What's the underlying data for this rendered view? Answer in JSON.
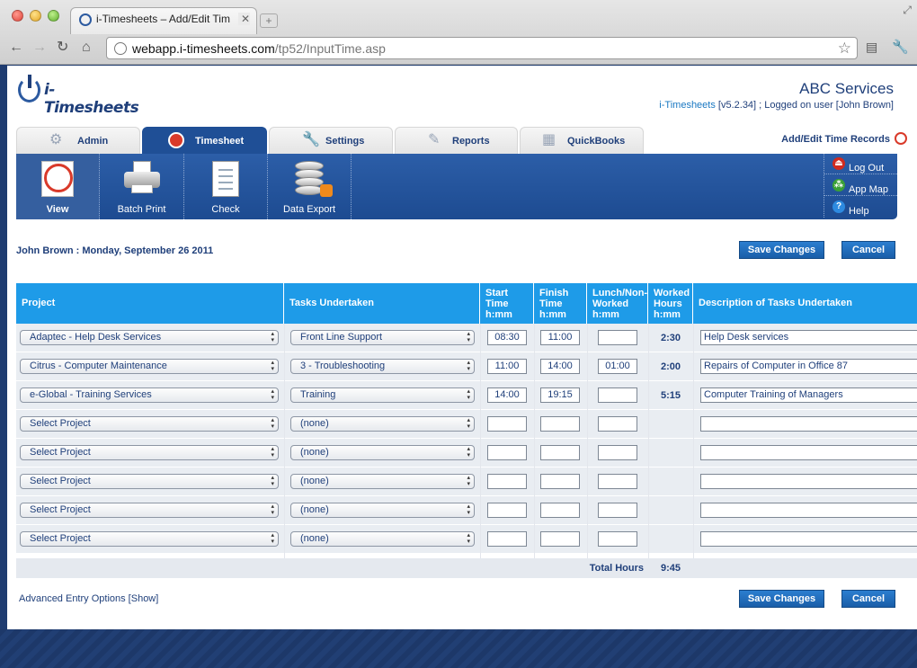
{
  "browser": {
    "tab_title": "i-Timesheets – Add/Edit Tim",
    "url_host": "webapp.i-timesheets.com",
    "url_path": "/tp52/InputTime.asp"
  },
  "header": {
    "logo_text": "i-Timesheets",
    "company": "ABC Services",
    "app_link": "i-Timesheets",
    "version_text": " [v5.2.34] ; Logged on user [John Brown]"
  },
  "tabs": [
    {
      "label": "Admin",
      "icon": "gear-icon"
    },
    {
      "label": "Timesheet",
      "icon": "clock-icon"
    },
    {
      "label": "Settings",
      "icon": "wrench-icon"
    },
    {
      "label": "Reports",
      "icon": "pen-icon"
    },
    {
      "label": "QuickBooks",
      "icon": "quickbooks-icon"
    }
  ],
  "page_heading": "Add/Edit Time Records",
  "toolbar": [
    {
      "label": "View",
      "icon": "clock-document-icon"
    },
    {
      "label": "Batch Print",
      "icon": "printer-icon"
    },
    {
      "label": "Check",
      "icon": "checklist-icon"
    },
    {
      "label": "Data Export",
      "icon": "database-export-icon"
    }
  ],
  "side_links": {
    "logout": "Log Out",
    "appmap": "App Map",
    "help": "Help"
  },
  "date_line": "John Brown : Monday, September 26 2011",
  "buttons": {
    "save": "Save Changes",
    "cancel": "Cancel"
  },
  "columns": {
    "project": "Project",
    "tasks": "Tasks Undertaken",
    "start": [
      "Start",
      "Time",
      "h:mm"
    ],
    "finish": [
      "Finish",
      "Time",
      "h:mm"
    ],
    "lunch": [
      "Lunch/Non-",
      "Worked",
      "h:mm"
    ],
    "worked": [
      "Worked",
      "Hours",
      "h:mm"
    ],
    "description": "Description of Tasks Undertaken"
  },
  "rows": [
    {
      "project": "Adaptec - Help Desk Services",
      "task": "Front Line Support",
      "start": "08:30",
      "finish": "11:00",
      "lunch": "",
      "worked": "2:30",
      "description": "Help Desk services"
    },
    {
      "project": "Citrus - Computer Maintenance",
      "task": "3 - Troubleshooting",
      "start": "11:00",
      "finish": "14:00",
      "lunch": "01:00",
      "worked": "2:00",
      "description": "Repairs of Computer in Office 87"
    },
    {
      "project": "e-Global - Training Services",
      "task": "Training",
      "start": "14:00",
      "finish": "19:15",
      "lunch": "",
      "worked": "5:15",
      "description": "Computer Training of Managers"
    },
    {
      "project": "Select Project",
      "task": "(none)",
      "start": "",
      "finish": "",
      "lunch": "",
      "worked": "",
      "description": ""
    },
    {
      "project": "Select Project",
      "task": "(none)",
      "start": "",
      "finish": "",
      "lunch": "",
      "worked": "",
      "description": ""
    },
    {
      "project": "Select Project",
      "task": "(none)",
      "start": "",
      "finish": "",
      "lunch": "",
      "worked": "",
      "description": ""
    },
    {
      "project": "Select Project",
      "task": "(none)",
      "start": "",
      "finish": "",
      "lunch": "",
      "worked": "",
      "description": ""
    },
    {
      "project": "Select Project",
      "task": "(none)",
      "start": "",
      "finish": "",
      "lunch": "",
      "worked": "",
      "description": ""
    }
  ],
  "totals": {
    "label": "Total Hours",
    "value": "9:45"
  },
  "advanced_link": "Advanced Entry Options [Show]",
  "colors": {
    "header_blue": "#1e9be8",
    "nav_blue": "#1f4f96",
    "text_navy": "#1f3f7a"
  }
}
